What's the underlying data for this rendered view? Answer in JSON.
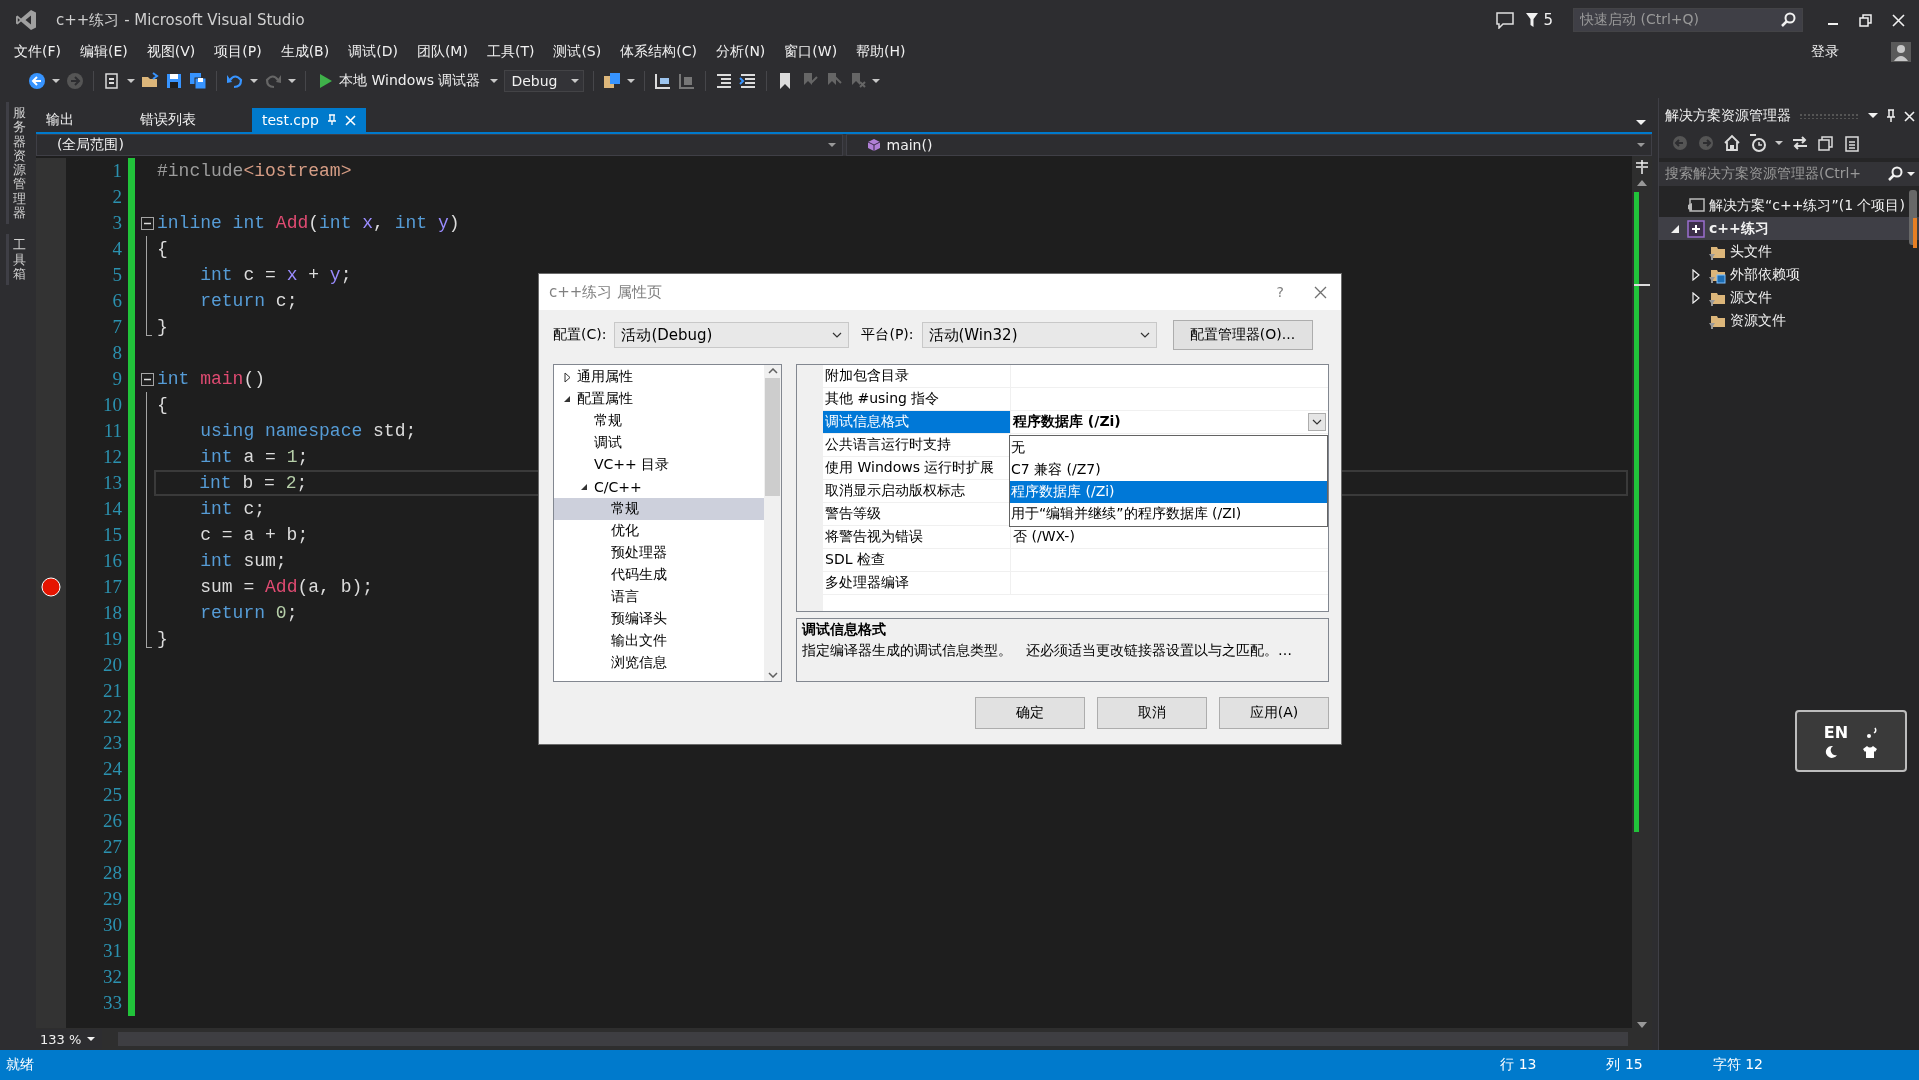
{
  "window": {
    "title": "c++练习 - Microsoft Visual Studio",
    "notification_count": "5",
    "quick_launch": {
      "placeholder": "快速启动 (Ctrl+Q)"
    },
    "sign_in": "登录"
  },
  "menu": [
    "文件(F)",
    "编辑(E)",
    "视图(V)",
    "项目(P)",
    "生成(B)",
    "调试(D)",
    "团队(M)",
    "工具(T)",
    "测试(S)",
    "体系结构(C)",
    "分析(N)",
    "窗口(W)",
    "帮助(H)"
  ],
  "toolbar": {
    "debugger": "本地 Windows 调试器",
    "configuration": "Debug"
  },
  "side_tabs": [
    "服务器资源管理器",
    "工具箱"
  ],
  "doc_tabs": [
    {
      "label": "输出",
      "selected": false
    },
    {
      "label": "错误列表",
      "selected": false
    },
    {
      "label": "test.cpp",
      "selected": true
    }
  ],
  "nav_bar": {
    "scope": "(全局范围)",
    "member": "main()"
  },
  "editor": {
    "zoom": "133 %",
    "lines": [
      {
        "number": "1",
        "collapsible": false,
        "in_block": false,
        "breakpoint": false,
        "current": false,
        "tokens": [
          {
            "kind": "directive",
            "text": "#include"
          },
          {
            "kind": "header",
            "text": "<iostream>"
          }
        ]
      },
      {
        "number": "2",
        "collapsible": false,
        "in_block": false,
        "breakpoint": false,
        "current": false
      },
      {
        "number": "3",
        "collapsible": true,
        "in_block": false,
        "breakpoint": false,
        "current": false,
        "tokens": [
          {
            "kind": "keyword",
            "text": "inline"
          },
          {
            "kind": "keyword",
            "text": " int"
          },
          {
            "kind": "function",
            "text": " Add"
          },
          {
            "kind": "plain",
            "text": "("
          },
          {
            "kind": "keyword",
            "text": "int"
          },
          {
            "kind": "param",
            "text": " x"
          },
          {
            "kind": "plain",
            "text": ", "
          },
          {
            "kind": "keyword",
            "text": "int"
          },
          {
            "kind": "param",
            "text": " y"
          },
          {
            "kind": "plain",
            "text": ")"
          }
        ]
      },
      {
        "number": "4",
        "collapsible": false,
        "in_block": true,
        "breakpoint": false,
        "current": false,
        "tokens": [
          {
            "kind": "plain",
            "text": "{"
          }
        ]
      },
      {
        "number": "5",
        "collapsible": false,
        "in_block": true,
        "breakpoint": false,
        "current": false,
        "tokens": [
          {
            "kind": "keyword",
            "text": "    int"
          },
          {
            "kind": "plain",
            "text": " c = "
          },
          {
            "kind": "param",
            "text": "x"
          },
          {
            "kind": "plain",
            "text": " + "
          },
          {
            "kind": "param",
            "text": "y"
          },
          {
            "kind": "plain",
            "text": ";"
          }
        ]
      },
      {
        "number": "6",
        "collapsible": false,
        "in_block": true,
        "breakpoint": false,
        "current": false,
        "tokens": [
          {
            "kind": "keyword",
            "text": "    return"
          },
          {
            "kind": "plain",
            "text": " c;"
          }
        ]
      },
      {
        "number": "7",
        "collapsible": false,
        "in_block": true,
        "breakpoint": false,
        "current": false,
        "tokens": [
          {
            "kind": "plain",
            "text": "}"
          }
        ]
      },
      {
        "number": "8",
        "collapsible": false,
        "in_block": false,
        "breakpoint": false,
        "current": false
      },
      {
        "number": "9",
        "collapsible": true,
        "in_block": false,
        "breakpoint": false,
        "current": false,
        "tokens": [
          {
            "kind": "keyword",
            "text": "int"
          },
          {
            "kind": "function",
            "text": " main"
          },
          {
            "kind": "plain",
            "text": "()"
          }
        ]
      },
      {
        "number": "10",
        "collapsible": false,
        "in_block": true,
        "breakpoint": false,
        "current": false,
        "tokens": [
          {
            "kind": "plain",
            "text": "{"
          }
        ]
      },
      {
        "number": "11",
        "collapsible": false,
        "in_block": true,
        "breakpoint": false,
        "current": false,
        "tokens": [
          {
            "kind": "keyword",
            "text": "    using"
          },
          {
            "kind": "keyword",
            "text": " namespace"
          },
          {
            "kind": "plain",
            "text": " std;"
          }
        ]
      },
      {
        "number": "12",
        "collapsible": false,
        "in_block": true,
        "breakpoint": false,
        "current": false,
        "tokens": [
          {
            "kind": "keyword",
            "text": "    int"
          },
          {
            "kind": "plain",
            "text": " a = "
          },
          {
            "kind": "number",
            "text": "1"
          },
          {
            "kind": "plain",
            "text": ";"
          }
        ]
      },
      {
        "number": "13",
        "collapsible": false,
        "in_block": true,
        "breakpoint": false,
        "current": true,
        "tokens": [
          {
            "kind": "keyword",
            "text": "    int"
          },
          {
            "kind": "plain",
            "text": " b = "
          },
          {
            "kind": "number",
            "text": "2"
          },
          {
            "kind": "plain",
            "text": ";"
          }
        ]
      },
      {
        "number": "14",
        "collapsible": false,
        "in_block": true,
        "breakpoint": false,
        "current": false,
        "tokens": [
          {
            "kind": "keyword",
            "text": "    int"
          },
          {
            "kind": "plain",
            "text": " c;"
          }
        ]
      },
      {
        "number": "15",
        "collapsible": false,
        "in_block": true,
        "breakpoint": false,
        "current": false,
        "tokens": [
          {
            "kind": "plain",
            "text": "    c = a + b;"
          }
        ]
      },
      {
        "number": "16",
        "collapsible": false,
        "in_block": true,
        "breakpoint": false,
        "current": false,
        "tokens": [
          {
            "kind": "keyword",
            "text": "    int"
          },
          {
            "kind": "plain",
            "text": " sum;"
          }
        ]
      },
      {
        "number": "17",
        "collapsible": false,
        "in_block": true,
        "breakpoint": true,
        "current": false,
        "tokens": [
          {
            "kind": "plain",
            "text": "    sum = "
          },
          {
            "kind": "function",
            "text": "Add"
          },
          {
            "kind": "plain",
            "text": "(a, b);"
          }
        ]
      },
      {
        "number": "18",
        "collapsible": false,
        "in_block": true,
        "breakpoint": false,
        "current": false,
        "tokens": [
          {
            "kind": "keyword",
            "text": "    return"
          },
          {
            "kind": "number",
            "text": " 0"
          },
          {
            "kind": "plain",
            "text": ";"
          }
        ]
      },
      {
        "number": "19",
        "collapsible": false,
        "in_block": true,
        "breakpoint": false,
        "current": false,
        "tokens": [
          {
            "kind": "plain",
            "text": "}"
          }
        ]
      },
      {
        "number": "20",
        "collapsible": false,
        "in_block": false,
        "breakpoint": false,
        "current": false
      },
      {
        "number": "21",
        "collapsible": false,
        "in_block": false,
        "breakpoint": false,
        "current": false
      },
      {
        "number": "22",
        "collapsible": false,
        "in_block": false,
        "breakpoint": false,
        "current": false
      },
      {
        "number": "23",
        "collapsible": false,
        "in_block": false,
        "breakpoint": false,
        "current": false
      },
      {
        "number": "24",
        "collapsible": false,
        "in_block": false,
        "breakpoint": false,
        "current": false
      },
      {
        "number": "25",
        "collapsible": false,
        "in_block": false,
        "breakpoint": false,
        "current": false
      },
      {
        "number": "26",
        "collapsible": false,
        "in_block": false,
        "breakpoint": false,
        "current": false
      },
      {
        "number": "27",
        "collapsible": false,
        "in_block": false,
        "breakpoint": false,
        "current": false
      },
      {
        "number": "28",
        "collapsible": false,
        "in_block": false,
        "breakpoint": false,
        "current": false
      },
      {
        "number": "29",
        "collapsible": false,
        "in_block": false,
        "breakpoint": false,
        "current": false
      },
      {
        "number": "30",
        "collapsible": false,
        "in_block": false,
        "breakpoint": false,
        "current": false
      },
      {
        "number": "31",
        "collapsible": false,
        "in_block": false,
        "breakpoint": false,
        "current": false
      },
      {
        "number": "32",
        "collapsible": false,
        "in_block": false,
        "breakpoint": false,
        "current": false
      },
      {
        "number": "33",
        "collapsible": false,
        "in_block": false,
        "breakpoint": false,
        "current": false
      }
    ]
  },
  "dialog": {
    "title": "c++练习 属性页",
    "help": "?",
    "config_label": "配置(C):",
    "config_value": "活动(Debug)",
    "platform_label": "平台(P):",
    "platform_value": "活动(Win32)",
    "manager_button": "配置管理器(O)...",
    "tree": [
      {
        "label": "通用属性",
        "expanded": false,
        "selected": false
      },
      {
        "label": "配置属性",
        "expanded": true,
        "selected": false,
        "children": [
          {
            "label": "常规",
            "selected": false
          },
          {
            "label": "调试",
            "selected": false
          },
          {
            "label": "VC++ 目录",
            "selected": false
          },
          {
            "label": "C/C++",
            "expanded": true,
            "selected": false,
            "children": [
              {
                "label": "常规",
                "selected": true
              },
              {
                "label": "优化",
                "selected": false
              },
              {
                "label": "预处理器",
                "selected": false
              },
              {
                "label": "代码生成",
                "selected": false
              },
              {
                "label": "语言",
                "selected": false
              },
              {
                "label": "预编译头",
                "selected": false
              },
              {
                "label": "输出文件",
                "selected": false
              },
              {
                "label": "浏览信息",
                "selected": false
              }
            ]
          }
        ]
      }
    ],
    "properties": [
      {
        "name": "附加包含目录",
        "selected": false
      },
      {
        "name": "其他 #using 指令",
        "selected": false
      },
      {
        "name": "调试信息格式",
        "value": "程序数据库 (/Zi)",
        "selected": true
      },
      {
        "name": "公共语言运行时支持",
        "selected": false
      },
      {
        "name": "使用 Windows 运行时扩展",
        "selected": false
      },
      {
        "name": "取消显示启动版权标志",
        "selected": false
      },
      {
        "name": "警告等级",
        "selected": false
      },
      {
        "name": "将警告视为错误",
        "value": "否 (/WX-)",
        "selected": false
      },
      {
        "name": "SDL 检查",
        "selected": false
      },
      {
        "name": "多处理器编译",
        "selected": false
      }
    ],
    "dropdown": [
      {
        "label": "无",
        "selected": false
      },
      {
        "label": "C7 兼容 (/Z7)",
        "selected": false
      },
      {
        "label": "程序数据库 (/Zi)",
        "selected": true
      },
      {
        "label": "用于“编辑并继续”的程序数据库 (/ZI)",
        "selected": false
      }
    ],
    "description": {
      "title": "调试信息格式",
      "text": "指定编译器生成的调试信息类型。　还必须适当更改链接器设置以与之匹配。…"
    },
    "buttons": [
      "确定",
      "取消",
      "应用(A)"
    ]
  },
  "solution_explorer": {
    "title": "解决方案资源管理器",
    "search": {
      "placeholder": "搜索解决方案资源管理器(Ctrl+"
    },
    "tree": [
      {
        "label": "解决方案“c++练习”(1 个项目)",
        "kind": "solution",
        "selected": false,
        "children": [
          {
            "label": "c++练习",
            "kind": "project",
            "expanded": true,
            "selected": true,
            "children": [
              {
                "label": "头文件",
                "kind": "filter",
                "selected": false
              },
              {
                "label": "外部依赖项",
                "kind": "dependencies",
                "expanded": false,
                "selected": false
              },
              {
                "label": "源文件",
                "kind": "filter",
                "expanded": false,
                "selected": false
              },
              {
                "label": "资源文件",
                "kind": "filter",
                "selected": false
              }
            ]
          }
        ]
      }
    ]
  },
  "ime": {
    "label": "EN"
  },
  "status_bar": {
    "message": "就绪",
    "line": "行 13",
    "column": "列 15",
    "char": "字符 12"
  }
}
